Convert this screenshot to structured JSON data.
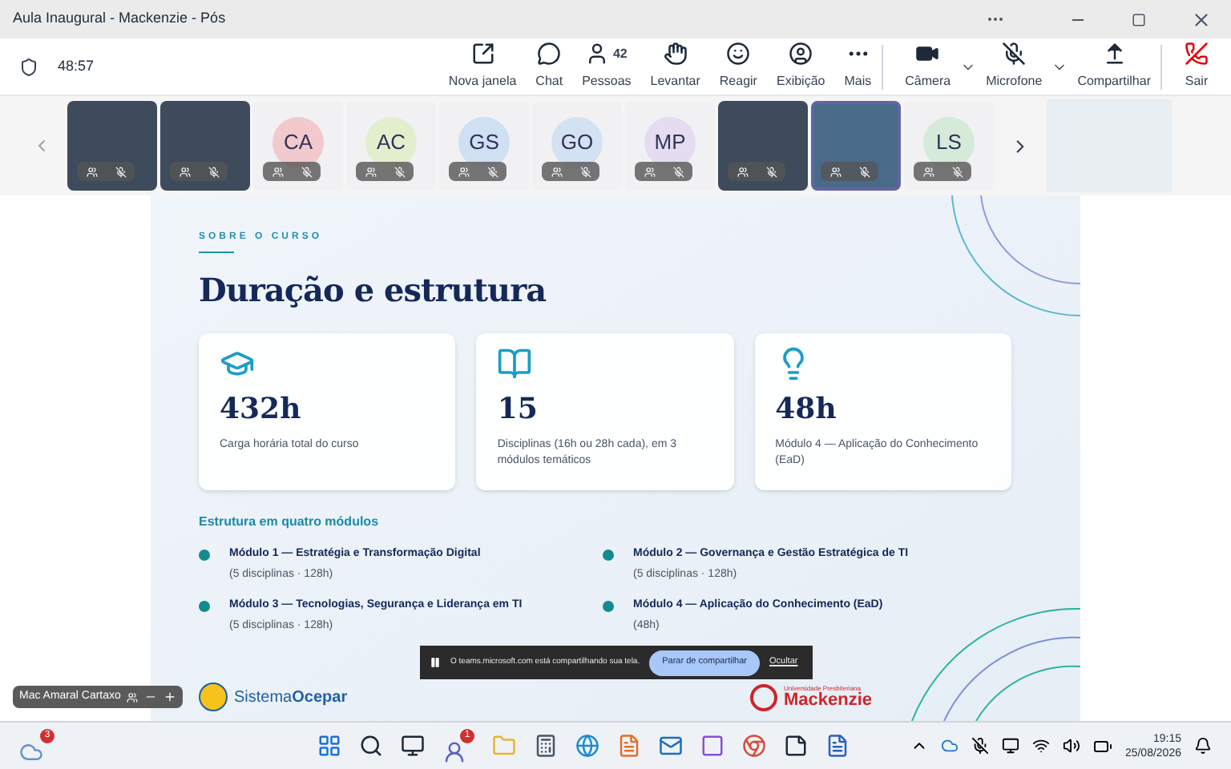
{
  "window": {
    "title": "Aula Inaugural - Mackenzie - Pós"
  },
  "toolbar": {
    "timer": "48:57",
    "buttons": [
      {
        "kind": "popout",
        "label": "Nova janela"
      },
      {
        "kind": "chat",
        "label": "Chat"
      },
      {
        "kind": "people",
        "label": "Pessoas",
        "badge": "42"
      },
      {
        "kind": "hand",
        "label": "Levantar"
      },
      {
        "kind": "react",
        "label": "Reagir"
      },
      {
        "kind": "view",
        "label": "Exibição"
      },
      {
        "kind": "more",
        "label": "Mais"
      },
      {
        "kind": "camera",
        "label": "Câmera"
      },
      {
        "kind": "mic",
        "label": "Microfone"
      },
      {
        "kind": "share",
        "label": "Compartilhar"
      },
      {
        "kind": "leave",
        "label": "Sair"
      }
    ]
  },
  "participants": [
    {
      "kind": "video",
      "selected": false
    },
    {
      "kind": "video",
      "selected": false
    },
    {
      "kind": "initials",
      "initials": "CA",
      "color": "#f2c9cc",
      "selected": false
    },
    {
      "kind": "initials",
      "initials": "AC",
      "color": "#e3eecd",
      "selected": false
    },
    {
      "kind": "initials",
      "initials": "GS",
      "color": "#cfe0f2",
      "selected": false
    },
    {
      "kind": "initials",
      "initials": "GO",
      "color": "#d3e2f3",
      "selected": false
    },
    {
      "kind": "initials",
      "initials": "MP",
      "color": "#e4dcf0",
      "selected": false
    },
    {
      "kind": "video",
      "selected": false
    },
    {
      "kind": "video",
      "selected": true
    },
    {
      "kind": "initials",
      "initials": "LS",
      "color": "#d6ead9",
      "selected": false
    }
  ],
  "slide": {
    "eyebrow": "SOBRE O CURSO",
    "title": "Duração e estrutura",
    "stats": [
      {
        "kind": "hours",
        "value": "432h",
        "caption": "Carga horária total do curso"
      },
      {
        "kind": "disciplines",
        "value": "15",
        "caption": "Disciplinas (16h ou 28h cada), em 3 módulos temáticos"
      },
      {
        "kind": "module",
        "value": "48h",
        "caption": "Módulo 4 — Aplicação do Conhecimento (EaD)"
      }
    ],
    "modules_heading": "Estrutura em quatro módulos",
    "modules": [
      {
        "title": "Módulo 1 — Estratégia e Transformação Digital",
        "detail": "(5 disciplinas · 128h)"
      },
      {
        "title": "Módulo 2 — Governança e Gestão Estratégica de TI",
        "detail": "(5 disciplinas · 128h)"
      },
      {
        "title": "Módulo 3 — Tecnologias, Segurança e Liderança em TI",
        "detail": "(5 disciplinas · 128h)"
      },
      {
        "title": "Módulo 4 — Aplicação do Conhecimento (EaD)",
        "detail": "(48h)"
      }
    ],
    "logo_left": {
      "part_1": "Sistema",
      "part_2": "Ocepar"
    },
    "logo_right": {
      "small": "Universidade Presbiteriana",
      "name": "Mackenzie"
    }
  },
  "share_bar": {
    "message": "O teams.microsoft.com está compartilhando sua tela.",
    "stop_button": "Parar de compartilhar",
    "hide_link": "Ocultar"
  },
  "self_view": {
    "name": "Mac Amaral Cartaxo"
  },
  "taskbar": {
    "weather_badge": "3",
    "teams_badge": "1",
    "time": "19:15",
    "date": "25/08/2026"
  }
}
